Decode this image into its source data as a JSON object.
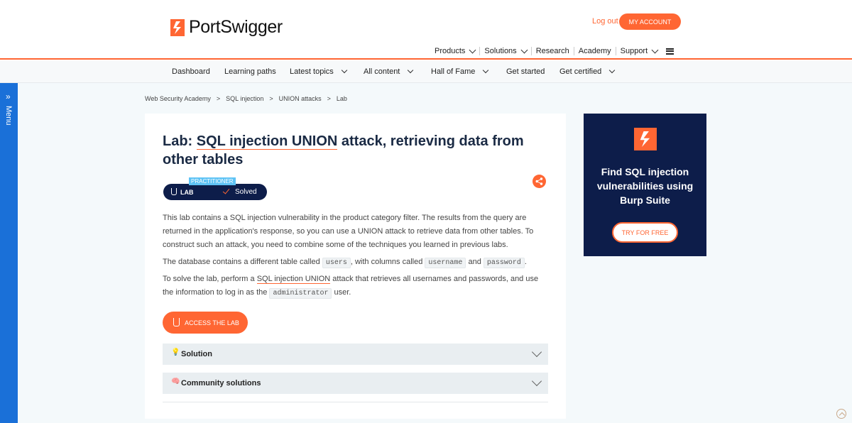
{
  "header": {
    "logo_text": "PortSwigger",
    "logout_label": "Log out",
    "account_label": "MY ACCOUNT",
    "nav": [
      "Products",
      "Solutions",
      "Research",
      "Academy",
      "Support"
    ]
  },
  "subnav": {
    "items": [
      "Dashboard",
      "Learning paths",
      "Latest topics",
      "All content",
      "Hall of Fame",
      "Get started",
      "Get certified"
    ]
  },
  "side_menu": {
    "label": "Menu"
  },
  "breadcrumb": [
    "Web Security Academy",
    ">",
    "SQL injection",
    ">",
    "UNION attacks",
    ">",
    "Lab"
  ],
  "lab": {
    "title_prefix": "Lab: ",
    "title_link": "SQL injection UNION",
    "title_suffix": " attack, retrieving data from other tables",
    "level_badge": "PRACTITIONER",
    "type_label": "LAB",
    "status_label": "Solved",
    "para1": "This lab contains a SQL injection vulnerability in the product category filter. The results from the query are returned in the application's response, so you can use a UNION attack to retrieve data from other tables. To construct such an attack, you need to combine some of the techniques you learned in previous labs.",
    "para2_a": "The database contains a different table called ",
    "code_users": "users",
    "para2_b": ", with columns called ",
    "code_username": "username",
    "para2_c": " and ",
    "code_password": "password",
    "para2_d": ".",
    "para3_a": "To solve the lab, perform a ",
    "para3_link": "SQL injection UNION",
    "para3_b": " attack that retrieves all usernames and passwords, and use the information to log in as the ",
    "code_admin": "administrator",
    "para3_c": " user.",
    "access_label": "ACCESS THE LAB",
    "accordions": [
      "Solution",
      "Community solutions"
    ]
  },
  "promo": {
    "text": "Find SQL injection vulnerabilities using Burp Suite",
    "button": "TRY FOR FREE"
  },
  "colors": {
    "accent": "#ff6633",
    "navy": "#0d1d4a",
    "menu_blue": "#1a70d8"
  }
}
